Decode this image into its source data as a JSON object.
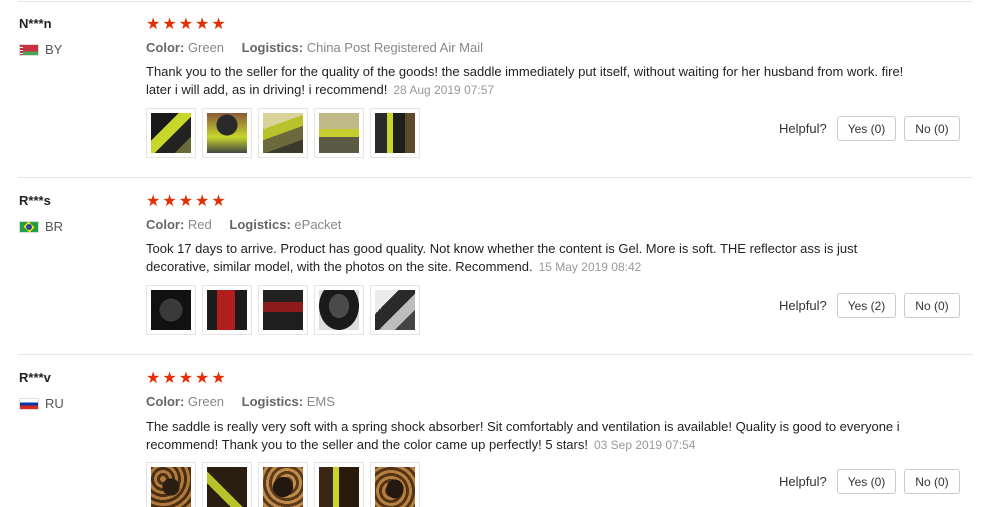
{
  "labels": {
    "color": "Color:",
    "logistics": "Logistics:",
    "helpful": "Helpful?"
  },
  "reviews": [
    {
      "user": "N***n",
      "country": "BY",
      "stars": 5,
      "color": "Green",
      "logistics": "China Post Registered Air Mail",
      "text": "Thank you to the seller for the quality of the goods! the saddle immediately put itself, without waiting for her husband from work. fire! later i will add, as in driving! i recommend!",
      "date": "28 Aug 2019 07:57",
      "yes": "Yes (0)",
      "no": "No (0)"
    },
    {
      "user": "R***s",
      "country": "BR",
      "stars": 5,
      "color": "Red",
      "logistics": "ePacket",
      "text": "Took 17 days to arrive. Product has good quality. Not know whether the content is Gel. More is soft. THE reflector ass is just decorative, similar model, with the photos on the site. Recommend.",
      "date": "15 May 2019 08:42",
      "yes": "Yes (2)",
      "no": "No (0)"
    },
    {
      "user": "R***v",
      "country": "RU",
      "stars": 5,
      "color": "Green",
      "logistics": "EMS",
      "text": "The saddle is really very soft with a spring shock absorber! Sit comfortably and ventilation is available! Quality is good to everyone i recommend! Thank you to the seller and the color came up perfectly! 5 stars!",
      "date": "03 Sep 2019 07:54",
      "yes": "Yes (0)",
      "no": "No (0)"
    }
  ]
}
